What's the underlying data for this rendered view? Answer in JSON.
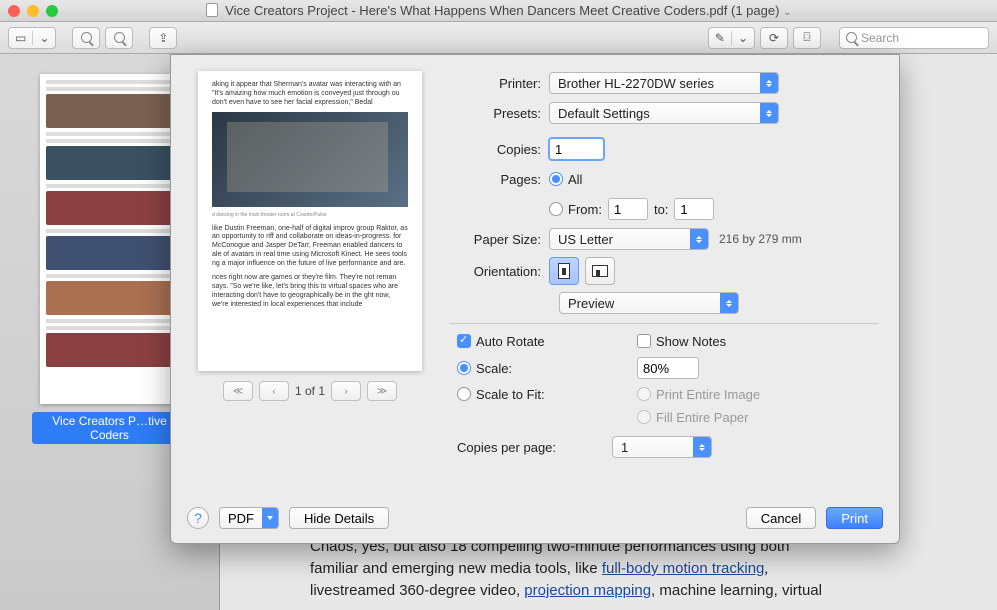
{
  "window": {
    "title": "Vice Creators Project - Here's What Happens When Dancers Meet Creative Coders.pdf (1 page)",
    "search_placeholder": "Search"
  },
  "sidebar": {
    "thumbnail_label": "Vice Creators P…tive Coders"
  },
  "background_text": {
    "line1_a": "Chaos, yes, but also 18 compelling two-minute performances using both",
    "line2_a": "familiar and emerging new media tools, like ",
    "line2_link": "full-body motion tracking",
    "line3_a": "livestreamed 360-degree video, ",
    "line3_link": "projection mapping",
    "line3_b": ", machine learning, virtual"
  },
  "dialog": {
    "labels": {
      "printer": "Printer:",
      "presets": "Presets:",
      "copies": "Copies:",
      "pages": "Pages:",
      "all": "All",
      "from": "From:",
      "to": "to:",
      "paper_size": "Paper Size:",
      "orientation": "Orientation:",
      "auto_rotate": "Auto Rotate",
      "show_notes": "Show Notes",
      "scale": "Scale:",
      "scale_to_fit": "Scale to Fit:",
      "print_entire_image": "Print Entire Image",
      "fill_entire_paper": "Fill Entire Paper",
      "copies_per_page": "Copies per page:"
    },
    "values": {
      "printer": "Brother HL-2270DW series",
      "presets": "Default Settings",
      "copies": "1",
      "from": "1",
      "to": "1",
      "paper_size": "US Letter",
      "paper_hint": "216 by 279 mm",
      "section": "Preview",
      "scale_value": "80%",
      "copies_per_page": "1"
    },
    "preview": {
      "page_counter": "1 of 1",
      "text1": "aking it appear that Sherman's avatar was interacting with an \"It's amazing how much emotion is conveyed just through ou don't even have to see her facial expression,\" Bedal",
      "caption": "d dancing in the main theater room at CounterPulse",
      "text2": "like Dustin Freeman, one-half of digital improv group Raktor, as an opportunity to riff and collaborate on ideas-in-progress. for McConogue and Jasper DeTarr, Freeman enabled dancers to ale of avatars in real time using Microsoft Kinect. He sees tools ng a major influence on the future of live performance and are.",
      "text3": "nces right now are games or they're film. They're not reman says. \"So we're like, let's bring this to virtual spaces who are interacting don't have to geographically be in the ght now, we're interested in local experiences that include"
    },
    "buttons": {
      "help": "?",
      "pdf": "PDF",
      "hide_details": "Hide Details",
      "cancel": "Cancel",
      "print": "Print"
    }
  }
}
